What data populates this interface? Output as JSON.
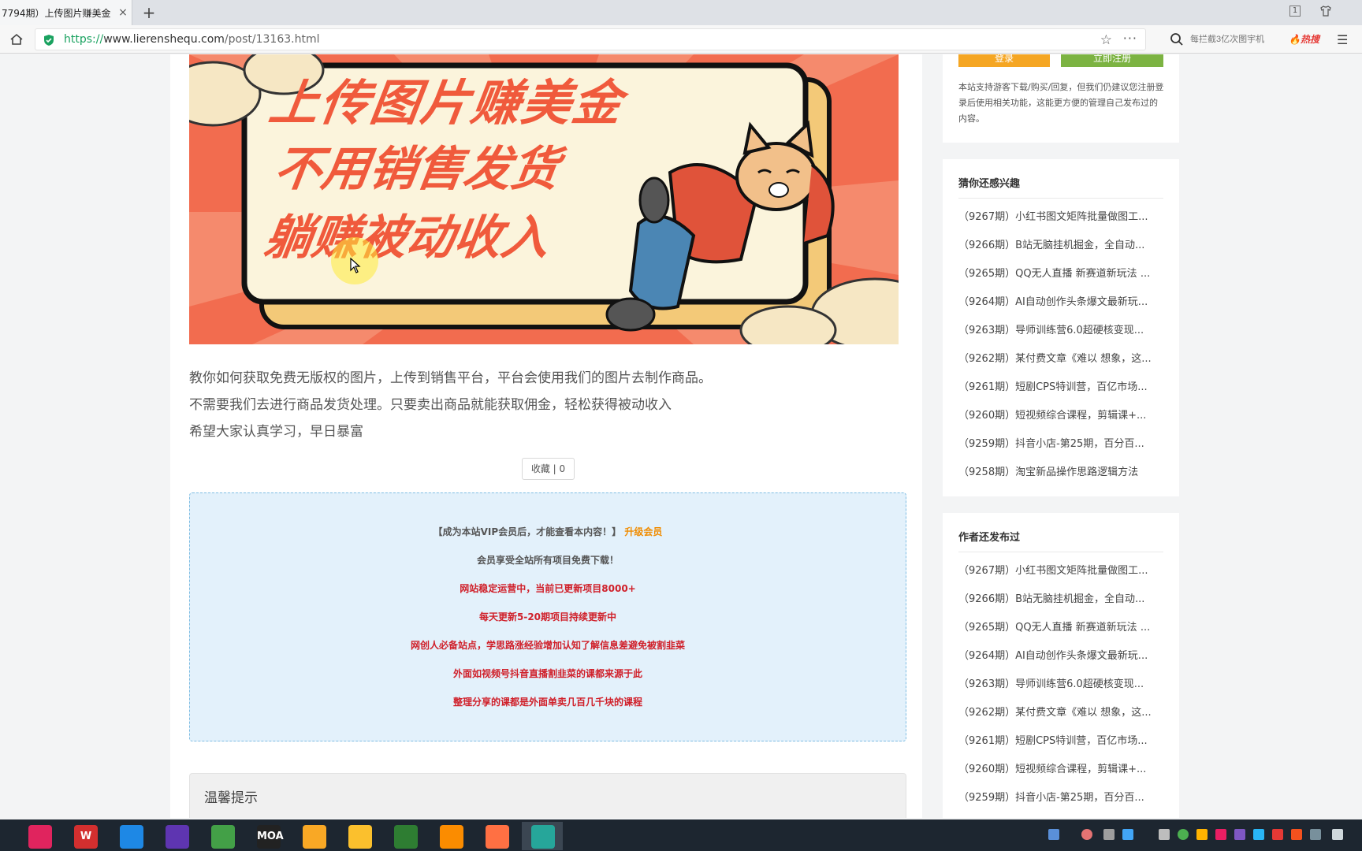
{
  "browser": {
    "tab_title": "7794期）上传图片赚美金",
    "tab_close": "×",
    "new_tab": "+",
    "window_badge": "1",
    "url_scheme": "https://",
    "url_host": "www.lierenshequ.com",
    "url_path": "/post/13163.html",
    "search_placeholder": "每拦截3亿次图宇机",
    "hot_label": "热搜"
  },
  "banner": {
    "line1": "上传图片赚美金",
    "line2": "不用销售发货",
    "line3": "躺赚被动收入"
  },
  "article": {
    "paragraphs": [
      "教你如何获取免费无版权的图片，上传到销售平台，平台会使用我们的图片去制作商品。",
      "不需要我们去进行商品发货处理。只要卖出商品就能获取佣金，轻松获得被动收入",
      "希望大家认真学习，早日暴富"
    ],
    "favorite_label": "收藏 | 0"
  },
  "vip": {
    "prompt": "【成为本站VIP会员后，才能查看本内容！】",
    "upgrade": "升级会员",
    "line1": "会员享受全站所有项目免费下载！",
    "line2": "网站稳定运营中，当前已更新项目8000+",
    "line3": "每天更新5-20期项目持续更新中",
    "line4": "网创人必备站点，学思路涨经验增加认知了解信息差避免被割韭菜",
    "line5": "外面如视频号抖音直播割韭菜的课都来源于此",
    "line6": "整理分享的课都是外面单卖几百几千块的课程"
  },
  "notice": {
    "title": "温馨提示"
  },
  "sidebar": {
    "login": "登录",
    "register": "立即注册",
    "login_note": "本站支持游客下载/购买/回复，但我们仍建议您注册登录后使用相关功能，这能更方便的管理自己发布过的内容。",
    "related_title": "猜你还感兴趣",
    "related": [
      "（9267期）小红书图文矩阵批量做图工...",
      "（9266期）B站无脑挂机掘金，全自动...",
      "（9265期）QQ无人直播 新赛道新玩法 ...",
      "（9264期）AI自动创作头条爆文最新玩...",
      "（9263期）导师训练营6.0超硬核变现...",
      "（9262期）某付费文章《难以 想象，这...",
      "（9261期）短剧CPS特训营，百亿市场...",
      "（9260期）短视频综合课程，剪辑课+...",
      "（9259期）抖音小店-第25期，百分百...",
      "（9258期）淘宝新品操作思路逻辑方法"
    ],
    "author_title": "作者还发布过",
    "author_posts": [
      "（9267期）小红书图文矩阵批量做图工...",
      "（9266期）B站无脑挂机掘金，全自动...",
      "（9265期）QQ无人直播 新赛道新玩法 ...",
      "（9264期）AI自动创作头条爆文最新玩...",
      "（9263期）导师训练营6.0超硬核变现...",
      "（9262期）某付费文章《难以 想象，这...",
      "（9261期）短剧CPS特训营，百亿市场...",
      "（9260期）短视频综合课程，剪辑课+...",
      "（9259期）抖音小店-第25期，百分百..."
    ]
  },
  "taskbar": {
    "apps": [
      {
        "name": "app-pink",
        "label": "",
        "color": "#e0245e"
      },
      {
        "name": "wps-app",
        "label": "W",
        "color": "#d32f2f"
      },
      {
        "name": "baidu-netdisk-app",
        "label": "",
        "color": "#1e88e5"
      },
      {
        "name": "video-editor-app",
        "label": "",
        "color": "#5e35b1"
      },
      {
        "name": "green-app",
        "label": "",
        "color": "#43a047"
      },
      {
        "name": "moa-app",
        "label": "MOA",
        "color": "#222222"
      },
      {
        "name": "file-explorer-app",
        "label": "",
        "color": "#f9a825"
      },
      {
        "name": "chrome-app",
        "label": "",
        "color": "#fbc02d"
      },
      {
        "name": "wechat-app",
        "label": "",
        "color": "#2e7d32"
      },
      {
        "name": "cloud-drive-app",
        "label": "",
        "color": "#fb8c00"
      },
      {
        "name": "media-app",
        "label": "",
        "color": "#ff7043"
      },
      {
        "name": "screen-recorder-app",
        "label": "",
        "color": "#26a69a"
      }
    ]
  }
}
